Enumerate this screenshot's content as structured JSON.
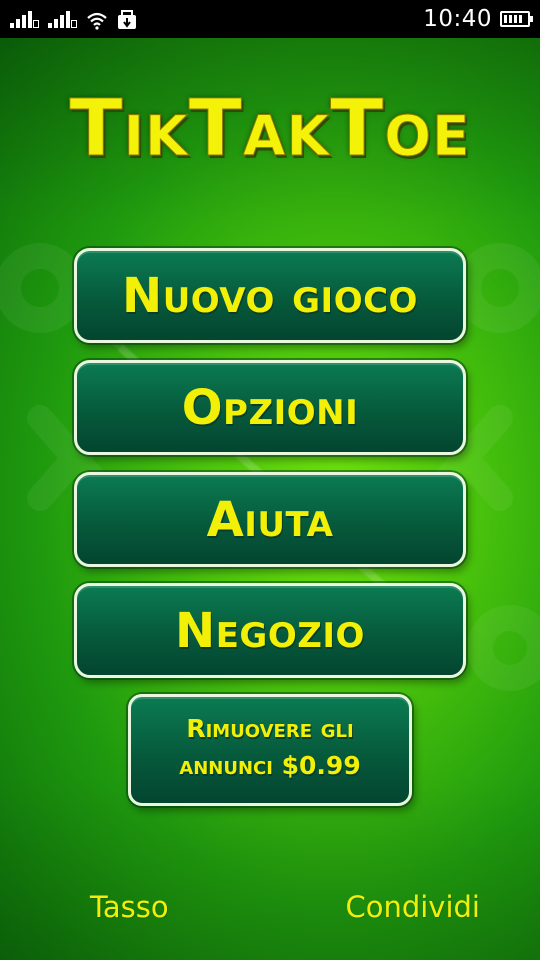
{
  "status_bar": {
    "time": "10:40",
    "icons": [
      "signal-icon",
      "signal-icon",
      "wifi-icon",
      "usb-icon",
      "battery-icon"
    ],
    "battery_level": 0.9
  },
  "app": {
    "title": "TikTakToe",
    "colors": {
      "background": "#3cb40d",
      "button": "#065a3c",
      "button_border": "#e9f7df",
      "text": "#f2f007"
    }
  },
  "menu": {
    "new_game": "Nuovo gioco",
    "options": "Opzioni",
    "help": "Aiuta",
    "shop": "Negozio",
    "remove_ads": "Rimuovere gli annunci $0.99"
  },
  "footer": {
    "rate": "Tasso",
    "share": "Condividi"
  }
}
